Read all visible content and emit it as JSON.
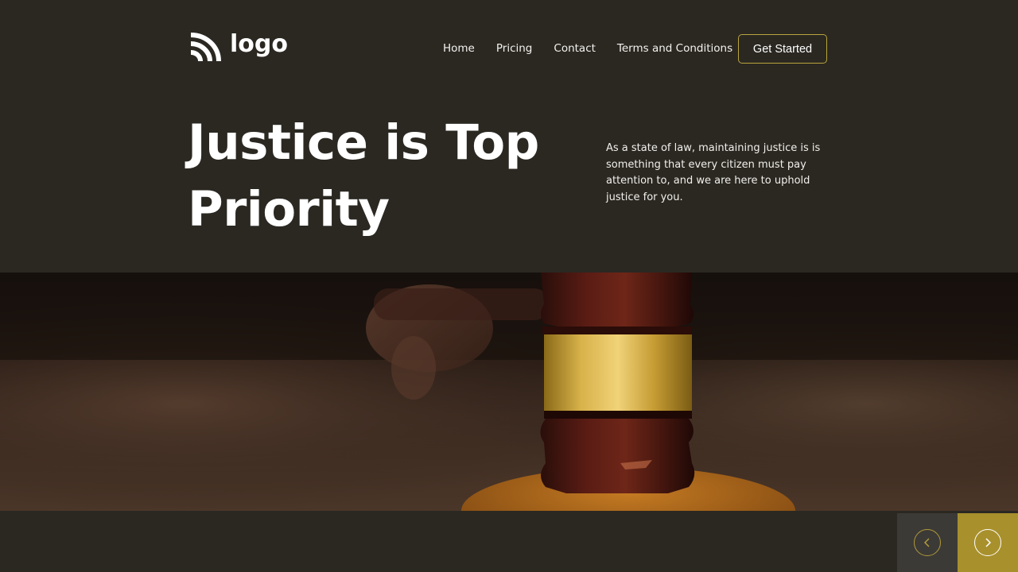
{
  "header": {
    "logo_text": "logo",
    "nav": [
      "Home",
      "Pricing",
      "Contact",
      "Terms and Conditions"
    ],
    "cta_label": "Get Started"
  },
  "hero": {
    "title": "Justice is Top Priority",
    "description": "As a state of law, maintaining justice is is something that every citizen must pay attention to, and we are here to uphold justice for you."
  },
  "banner": {
    "image": "gavel-photo"
  },
  "slider": {
    "prev_icon": "chevron-left-icon",
    "next_icon": "chevron-right-icon"
  },
  "colors": {
    "background": "#2b2822",
    "accent": "#a8902c",
    "button_border": "#b8a43c"
  }
}
